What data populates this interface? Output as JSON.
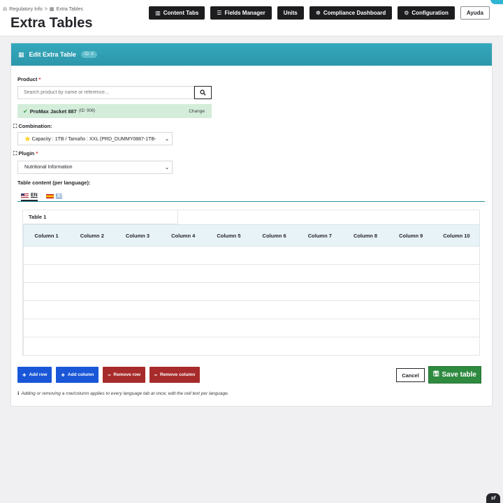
{
  "breadcrumb": {
    "root_icon": "⚖",
    "root": "Regulatory Info",
    "sep": ">",
    "current_icon": "▦",
    "current": "Extra Tables"
  },
  "page_title": "Extra Tables",
  "header_buttons": [
    {
      "icon": "▥",
      "label": "Content Tabs"
    },
    {
      "icon": "☰",
      "label": "Fields Manager"
    },
    {
      "icon": "",
      "label": "Units"
    },
    {
      "icon": "☸",
      "label": "Compliance Dashboard"
    },
    {
      "icon": "⚙",
      "label": "Configuration"
    },
    {
      "icon": "",
      "label": "Ayuda"
    }
  ],
  "panel": {
    "icon": "▦",
    "title": "Edit Extra Table",
    "id_badge": "ID: 4"
  },
  "product": {
    "label": "Product",
    "required_mark": "*",
    "search_placeholder": "Search product by name or reference...",
    "search_icon": "search-icon",
    "selected_name": "ProMax Jacket 887",
    "selected_id": "(ID: 906)",
    "change_label": "Change"
  },
  "combination": {
    "label": "Combination:",
    "value": "⭐ Capacity : 1TB / Tamaño : XXL (PRD_DUMMY0887-1TB-"
  },
  "plugin": {
    "label": "Plugin",
    "required_mark": "*",
    "value": "Nutritional Information"
  },
  "table_content_label": "Table content (per language):",
  "languages": [
    {
      "code": "EN",
      "active": true
    },
    {
      "code": "ES",
      "active": false
    }
  ],
  "table": {
    "name": "Table 1",
    "columns": [
      "Column 1",
      "Column 2",
      "Column 3",
      "Column 4",
      "Column 5",
      "Column 6",
      "Column 7",
      "Column 8",
      "Column 9",
      "Column 10"
    ],
    "row_count": 6
  },
  "actions": {
    "add_row": "Add row",
    "add_column": "Add column",
    "remove_row": "Remove row",
    "remove_column": "Remove column",
    "cancel": "Cancel",
    "save": "Save table"
  },
  "hint": "Adding or removing a row/column applies to every language tab at once; edit the cell text per language.",
  "colors": {
    "accent": "#30a0b4",
    "primary_blue": "#1957d8",
    "danger": "#a82b2b",
    "success": "#2e8a3f"
  }
}
